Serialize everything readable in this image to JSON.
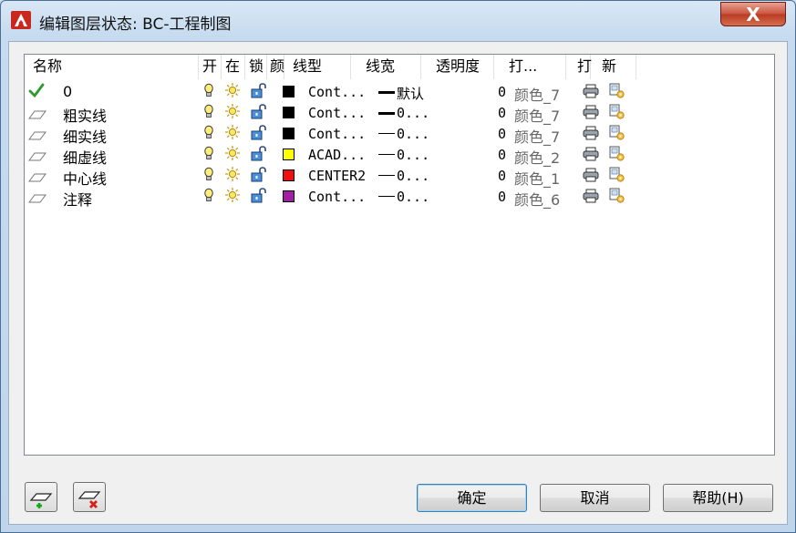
{
  "window": {
    "title": "编辑图层状态: BC-工程制图",
    "close_label": "X"
  },
  "columns": [
    "名称",
    "开",
    "在",
    "锁",
    "颜",
    "线型",
    "线宽",
    "透明度",
    "打...",
    "打",
    "新"
  ],
  "rows": [
    {
      "name": "0",
      "current": true,
      "color": "#000000",
      "linetype": "Cont...",
      "lineweight": "默认",
      "lw_heavy": true,
      "transparency": "0",
      "plotstyle": "颜色_7"
    },
    {
      "name": "粗实线",
      "current": false,
      "color": "#000000",
      "linetype": "Cont...",
      "lineweight": "0...",
      "lw_heavy": true,
      "transparency": "0",
      "plotstyle": "颜色_7"
    },
    {
      "name": "细实线",
      "current": false,
      "color": "#000000",
      "linetype": "Cont...",
      "lineweight": "0...",
      "lw_heavy": false,
      "transparency": "0",
      "plotstyle": "颜色_7"
    },
    {
      "name": "细虚线",
      "current": false,
      "color": "#ffff00",
      "linetype": "ACAD...",
      "lineweight": "0...",
      "lw_heavy": false,
      "transparency": "0",
      "plotstyle": "颜色_2"
    },
    {
      "name": "中心线",
      "current": false,
      "color": "#ee1111",
      "linetype": "CENTER2",
      "lineweight": "0...",
      "lw_heavy": false,
      "transparency": "0",
      "plotstyle": "颜色_1"
    },
    {
      "name": "注释",
      "current": false,
      "color": "#a020a0",
      "linetype": "Cont...",
      "lineweight": "0...",
      "lw_heavy": false,
      "transparency": "0",
      "plotstyle": "颜色_6"
    }
  ],
  "icons": {
    "on": "lightbulb-icon",
    "freeze": "sun-icon",
    "lock": "unlocked-padlock-icon",
    "plot": "printer-icon",
    "newvp": "new-viewport-freeze-icon",
    "current": "checkmark-icon",
    "layer": "layer-sheet-icon"
  },
  "buttons": {
    "ok": "确定",
    "cancel": "取消",
    "help": "帮助(H)"
  }
}
